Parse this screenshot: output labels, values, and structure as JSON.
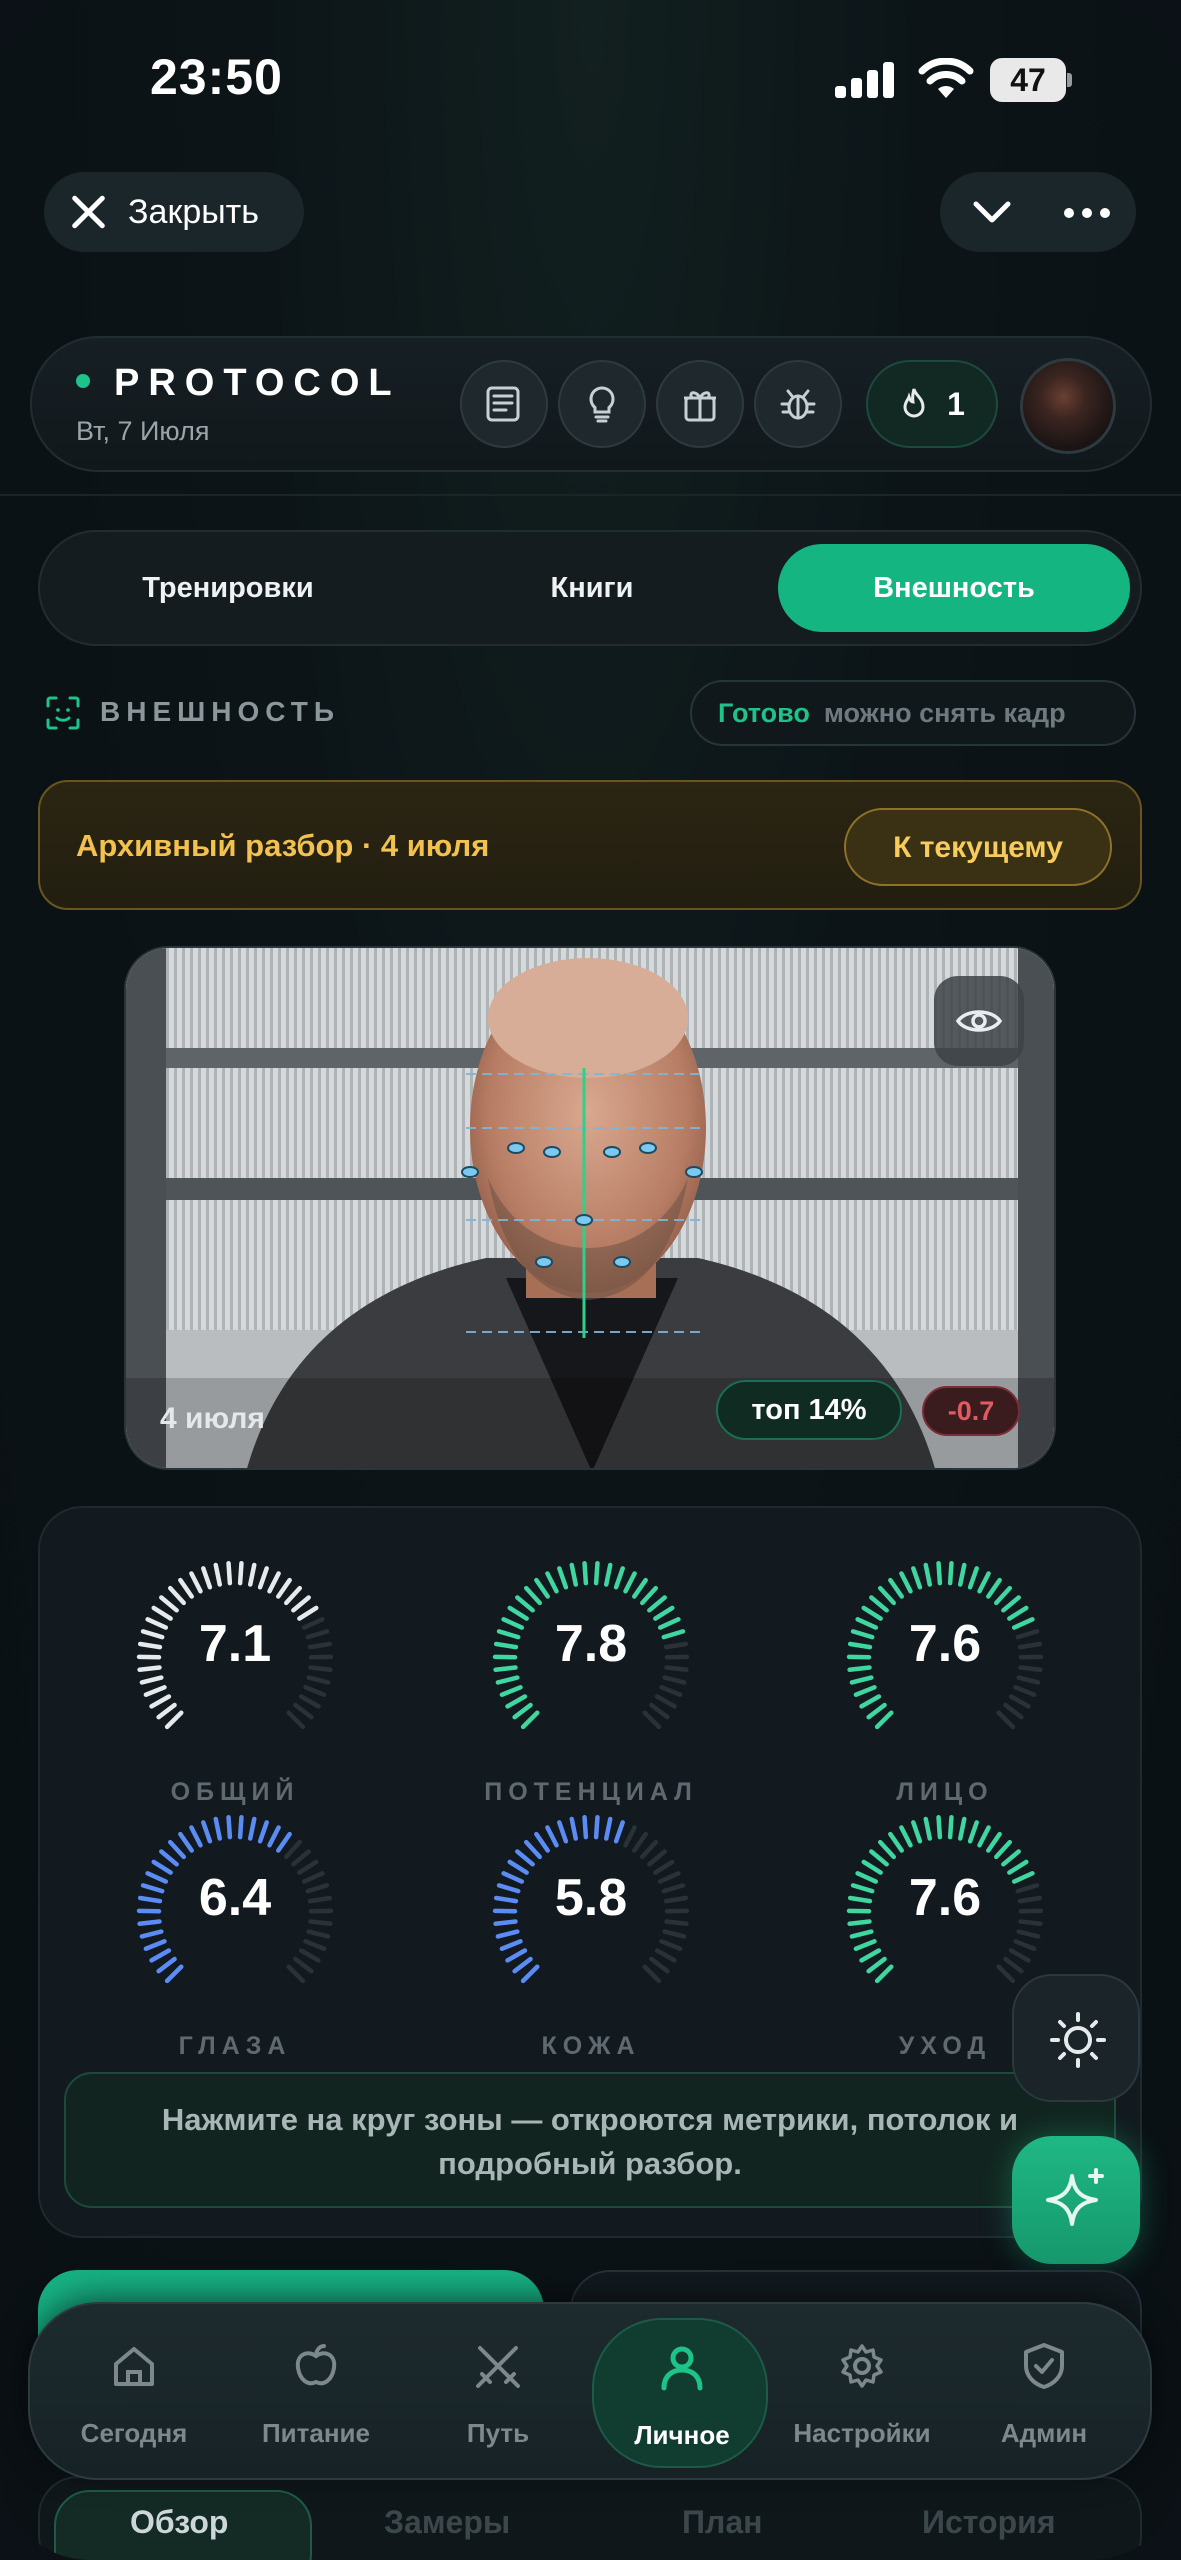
{
  "status_bar": {
    "time": "23:50",
    "battery": "47"
  },
  "top": {
    "close_label": "Закрыть"
  },
  "header": {
    "title": "PROTOCOL",
    "date": "Вт, 7 Июля",
    "streak": "1"
  },
  "tabs": [
    {
      "label": "Тренировки"
    },
    {
      "label": "Книги"
    },
    {
      "label": "Внешность"
    }
  ],
  "section": {
    "title": "ВНЕШНОСТЬ",
    "ready_label": "Готово",
    "ready_hint": "можно снять кадр"
  },
  "archive": {
    "text": "Архивный разбор · 4 июля",
    "button": "К текущему"
  },
  "photo": {
    "date": "4 июля",
    "rank": "топ 14%",
    "delta": "-0.7"
  },
  "scores": [
    {
      "value": "7.1",
      "label": "ОБЩИЙ",
      "fraction": 0.71,
      "color": "#e6eaec"
    },
    {
      "value": "7.8",
      "label": "ПОТЕНЦИАЛ",
      "fraction": 0.78,
      "color": "#3fd6a0"
    },
    {
      "value": "7.6",
      "label": "ЛИЦО",
      "fraction": 0.76,
      "color": "#3fd6a0"
    },
    {
      "value": "6.4",
      "label": "ГЛАЗА",
      "fraction": 0.64,
      "color": "#5b8cf5"
    },
    {
      "value": "5.8",
      "label": "КОЖА",
      "fraction": 0.58,
      "color": "#5b8cf5"
    },
    {
      "value": "7.6",
      "label": "УХОД",
      "fraction": 0.76,
      "color": "#3fd6a0"
    }
  ],
  "hint": "Нажмите на круг зоны — откроются метрики, потолок и подробный разбор.",
  "nav": [
    {
      "label": "Сегодня",
      "icon": "home-icon"
    },
    {
      "label": "Питание",
      "icon": "apple-icon"
    },
    {
      "label": "Путь",
      "icon": "swords-icon"
    },
    {
      "label": "Личное",
      "icon": "person-icon"
    },
    {
      "label": "Настройки",
      "icon": "gear-icon"
    },
    {
      "label": "Админ",
      "icon": "shield-icon"
    }
  ],
  "segments": [
    {
      "label": "Обзор"
    },
    {
      "label": "Замеры"
    },
    {
      "label": "План"
    },
    {
      "label": "История"
    }
  ],
  "colors": {
    "accent": "#15b582",
    "gold": "#f2c14e",
    "danger": "#e15a62"
  }
}
